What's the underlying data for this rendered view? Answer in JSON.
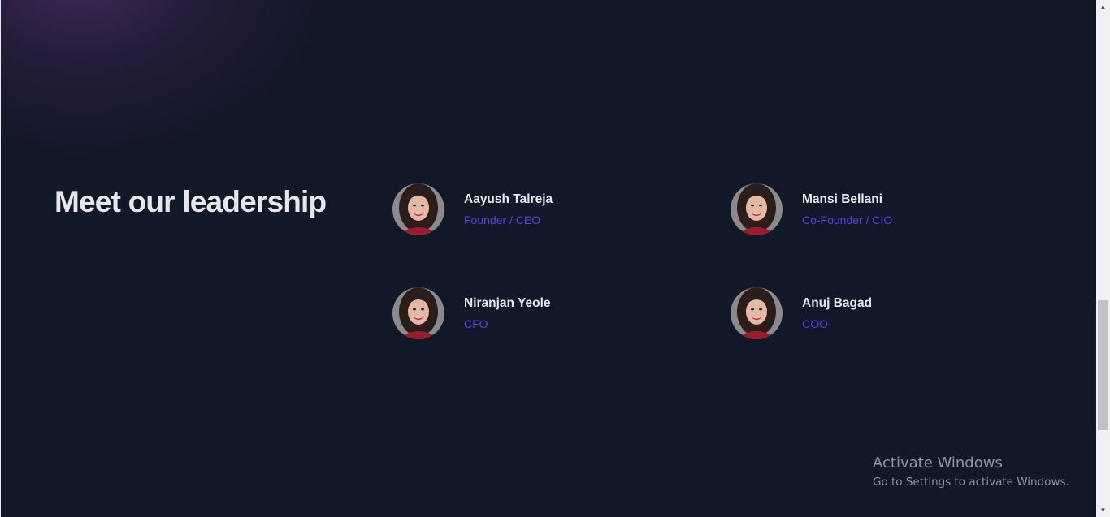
{
  "section": {
    "heading": "Meet our leadership"
  },
  "leaders": [
    {
      "name": "Aayush Talreja",
      "role": "Founder / CEO"
    },
    {
      "name": "Mansi Bellani",
      "role": "Co-Founder / CIO"
    },
    {
      "name": "Niranjan Yeole",
      "role": "CFO"
    },
    {
      "name": "Anuj Bagad",
      "role": "COO"
    }
  ],
  "watermark": {
    "title": "Activate Windows",
    "subtitle": "Go to Settings to activate Windows."
  },
  "colors": {
    "background": "#111827",
    "heading": "#e5e7eb",
    "name": "#e5e7eb",
    "role": "#4f46e5",
    "glow": "#4a2c5e"
  },
  "scrollbar": {
    "up_icon": "scroll-up-arrow-icon",
    "down_icon": "scroll-down-arrow-icon"
  }
}
